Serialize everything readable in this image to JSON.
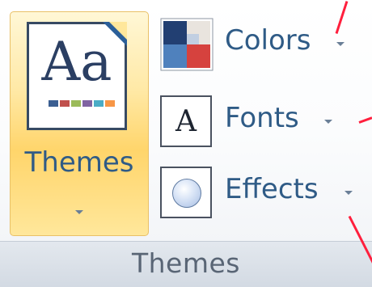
{
  "ribbon_group": {
    "label": "Themes",
    "themes_button": {
      "label": "Themes",
      "thumbnail_text": "Aa",
      "swatches": [
        "#3b5e91",
        "#c0504d",
        "#9bbb59",
        "#8064a2",
        "#4bacc6",
        "#f79646"
      ]
    },
    "commands": [
      {
        "label": "Colors",
        "icon": "color-scheme-icon"
      },
      {
        "label": "Fonts",
        "icon": "font-letter-icon",
        "icon_text": "A"
      },
      {
        "label": "Effects",
        "icon": "effects-circle-icon"
      }
    ]
  },
  "colors": {
    "annotation_lines": "#ff1f3d",
    "label_text": "#2f5b86",
    "selected_button": "#ffd56b"
  }
}
